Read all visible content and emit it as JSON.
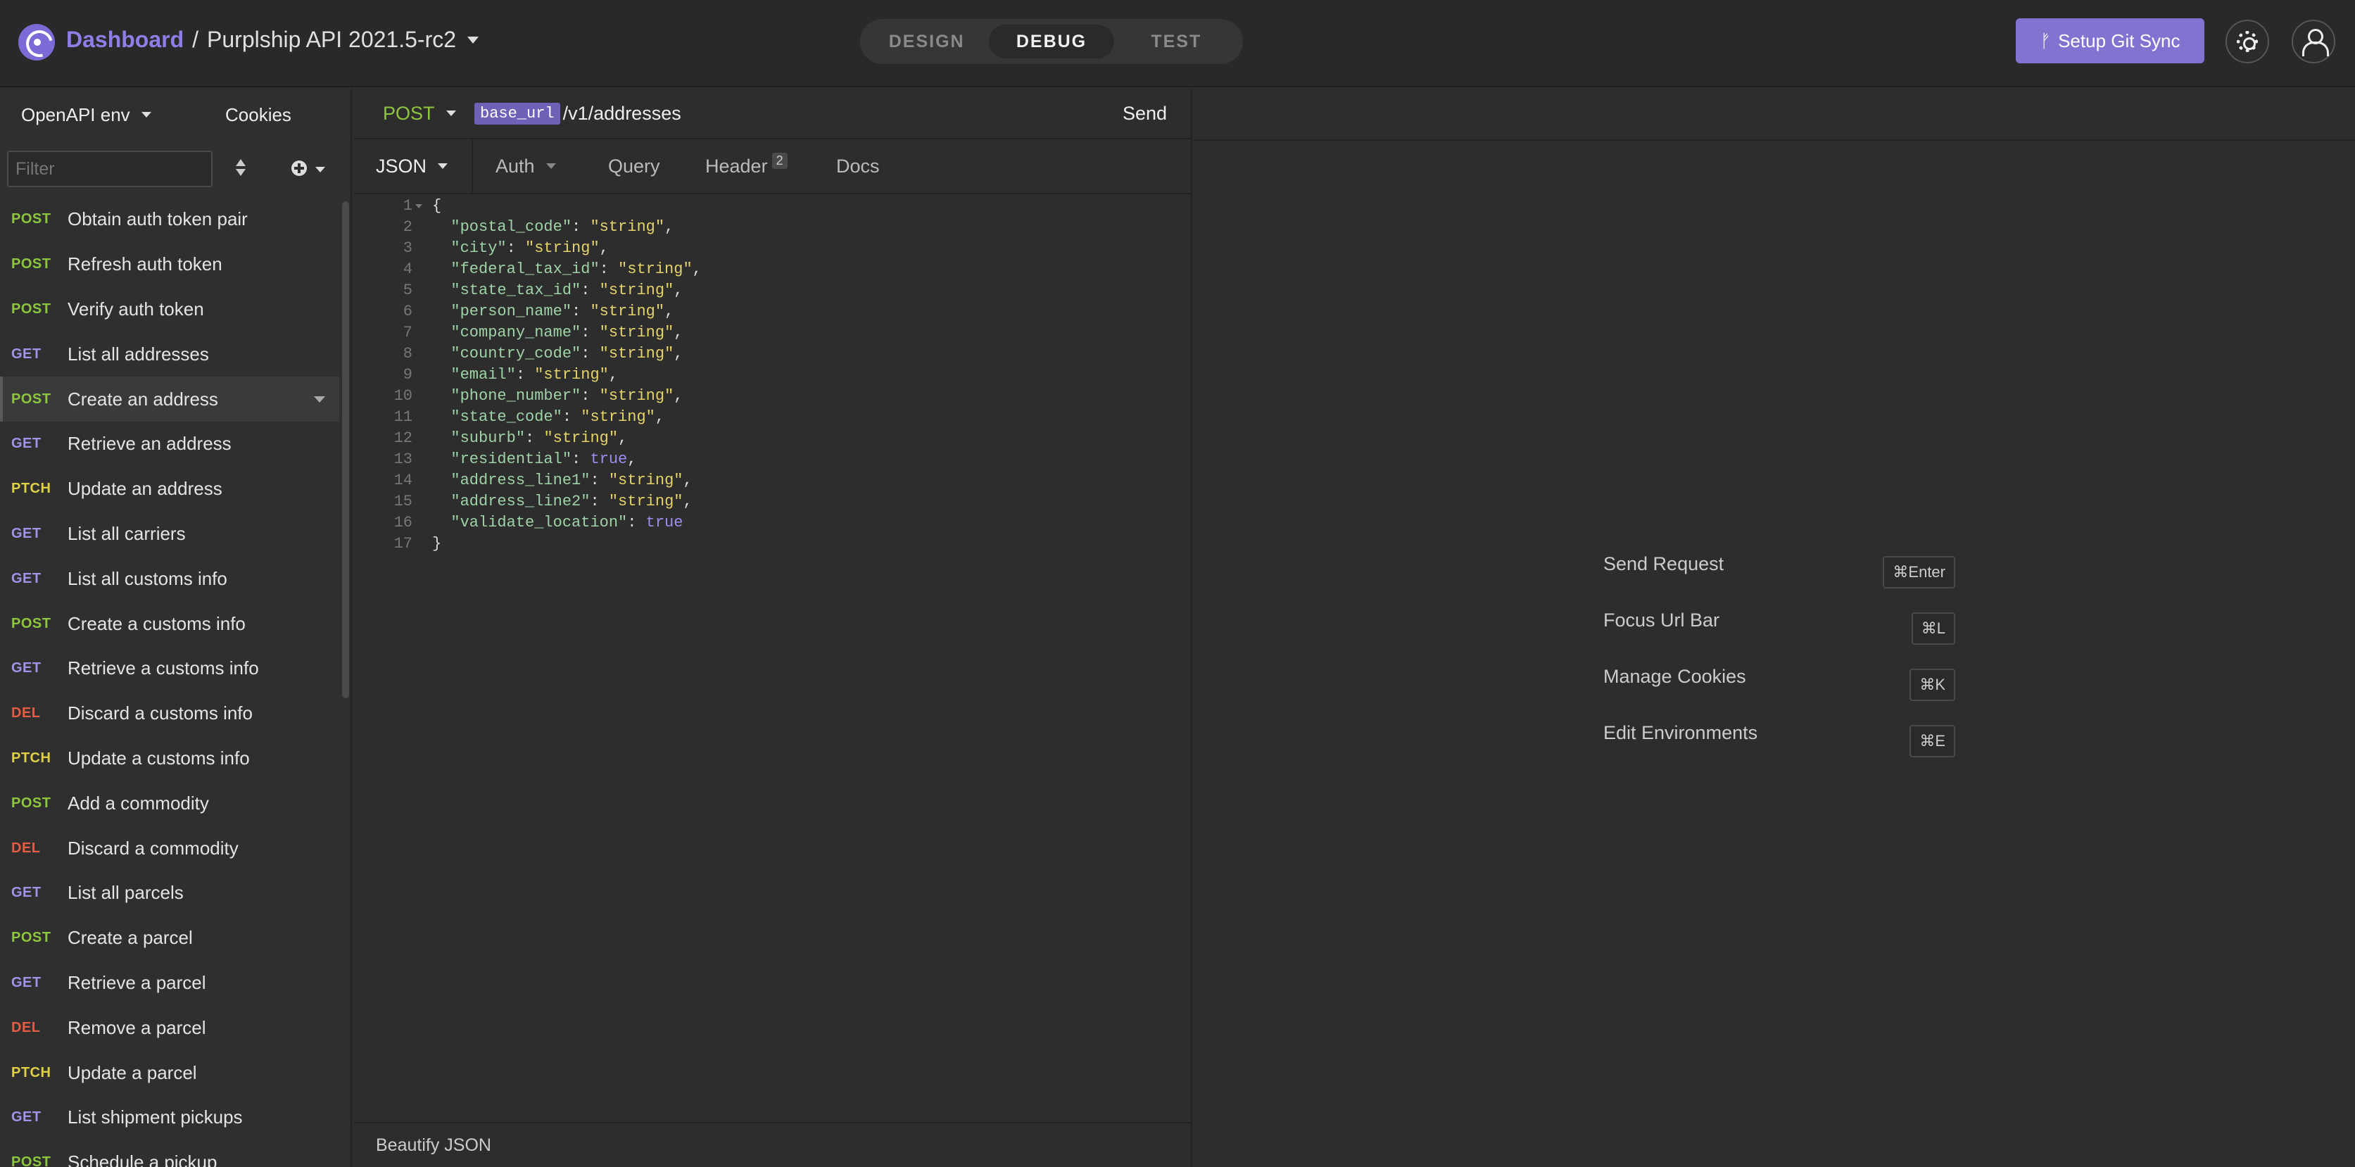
{
  "header": {
    "dashboard": "Dashboard",
    "separator": "/",
    "project": "Purplship API 2021.5-rc2",
    "modes": [
      "DESIGN",
      "DEBUG",
      "TEST"
    ],
    "active_mode": "DEBUG",
    "git_sync": "Setup Git Sync",
    "accent_color": "#8273d0"
  },
  "sidebar": {
    "env": "OpenAPI env",
    "cookies": "Cookies",
    "filter_placeholder": "Filter",
    "requests": [
      {
        "method": "POST",
        "name": "Obtain auth token pair"
      },
      {
        "method": "POST",
        "name": "Refresh auth token"
      },
      {
        "method": "POST",
        "name": "Verify auth token"
      },
      {
        "method": "GET",
        "name": "List all addresses"
      },
      {
        "method": "POST",
        "name": "Create an address"
      },
      {
        "method": "GET",
        "name": "Retrieve an address"
      },
      {
        "method": "PTCH",
        "name": "Update an address"
      },
      {
        "method": "GET",
        "name": "List all carriers"
      },
      {
        "method": "GET",
        "name": "List all customs info"
      },
      {
        "method": "POST",
        "name": "Create a customs info"
      },
      {
        "method": "GET",
        "name": "Retrieve a customs info"
      },
      {
        "method": "DEL",
        "name": "Discard a customs info"
      },
      {
        "method": "PTCH",
        "name": "Update a customs info"
      },
      {
        "method": "POST",
        "name": "Add a commodity"
      },
      {
        "method": "DEL",
        "name": "Discard a commodity"
      },
      {
        "method": "GET",
        "name": "List all parcels"
      },
      {
        "method": "POST",
        "name": "Create a parcel"
      },
      {
        "method": "GET",
        "name": "Retrieve a parcel"
      },
      {
        "method": "DEL",
        "name": "Remove a parcel"
      },
      {
        "method": "PTCH",
        "name": "Update a parcel"
      },
      {
        "method": "GET",
        "name": "List shipment pickups"
      },
      {
        "method": "POST",
        "name": "Schedule a pickup"
      }
    ],
    "active_index": 4
  },
  "request": {
    "method": "POST",
    "url_tag": "base_url",
    "url_path": "/v1/addresses",
    "send": "Send",
    "tabs": {
      "body": "JSON",
      "auth": "Auth",
      "query": "Query",
      "header": "Header",
      "header_count": "2",
      "docs": "Docs"
    },
    "body_lines": [
      "{",
      "  \"postal_code\": \"string\",",
      "  \"city\": \"string\",",
      "  \"federal_tax_id\": \"string\",",
      "  \"state_tax_id\": \"string\",",
      "  \"person_name\": \"string\",",
      "  \"company_name\": \"string\",",
      "  \"country_code\": \"string\",",
      "  \"email\": \"string\",",
      "  \"phone_number\": \"string\",",
      "  \"state_code\": \"string\",",
      "  \"suburb\": \"string\",",
      "  \"residential\": true,",
      "  \"address_line1\": \"string\",",
      "  \"address_line2\": \"string\",",
      "  \"validate_location\": true",
      "}"
    ],
    "footer": "Beautify JSON"
  },
  "response": {
    "shortcuts": [
      {
        "label": "Send Request",
        "key": "⌘Enter"
      },
      {
        "label": "Focus Url Bar",
        "key": "⌘L"
      },
      {
        "label": "Manage Cookies",
        "key": "⌘K"
      },
      {
        "label": "Edit Environments",
        "key": "⌘E"
      }
    ]
  }
}
